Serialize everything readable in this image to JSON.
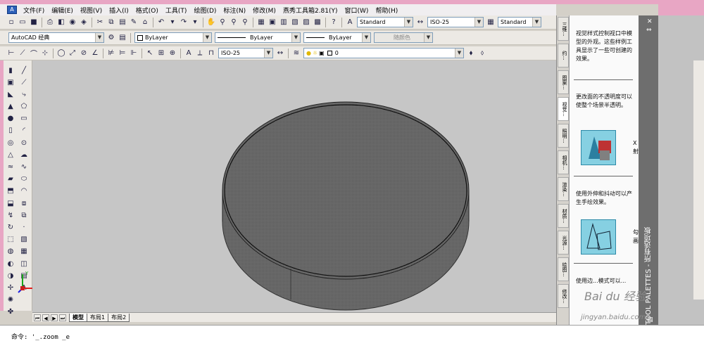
{
  "menubar": {
    "items": [
      "文件(F)",
      "编辑(E)",
      "视图(V)",
      "插入(I)",
      "格式(O)",
      "工具(T)",
      "绘图(D)",
      "标注(N)",
      "修改(M)",
      "燕秀工具箱2.81(Y)",
      "窗口(W)",
      "帮助(H)"
    ]
  },
  "toolbar1": {
    "text_style": "Standard",
    "dim_style": "ISO-25",
    "table_style": "Standard"
  },
  "toolbar2": {
    "workspace": "AutoCAD 经典",
    "layer_color": "ByLayer",
    "linetype": "ByLayer",
    "lineweight": "ByLayer",
    "plot_style": "随颜色"
  },
  "toolbar3": {
    "dim_style": "ISO-25",
    "layer_name": "0"
  },
  "layout_tabs": [
    "模型",
    "布局1",
    "布局2"
  ],
  "command_line": "命令: '_.zoom _e",
  "ucs": {
    "x_label": "X",
    "y_label": "Y"
  },
  "palette": {
    "title": "TOOL PALETTES - 所有选项板",
    "vtabs": [
      "三维...",
      "约...",
      "图案...",
      "视觉...",
      "照明...",
      "相机...",
      "渲染...",
      "材质...",
      "光源...",
      "绘图...",
      "修改..."
    ],
    "desc1": "视觉样式控制视口中模型的外观。这些样例工具显示了一些可创建的效果。",
    "desc2": "更改面的不透明度可以使整个场景半透明。",
    "tool1_label": "X\n射",
    "desc3": "使用外伸和抖动可以产生手绘效果。",
    "tool2_label": "勾\n画",
    "desc4": "使用边...模式可以..."
  },
  "watermark": "Bai du 经验",
  "watermark_url": "jingyan.baidu.com",
  "colors": {
    "accent_pink": "#e8a6c4",
    "viewport": "#c6c6c6",
    "cylinder_fill": "#6c6c6c",
    "palette_tool": "#86d0e2"
  }
}
